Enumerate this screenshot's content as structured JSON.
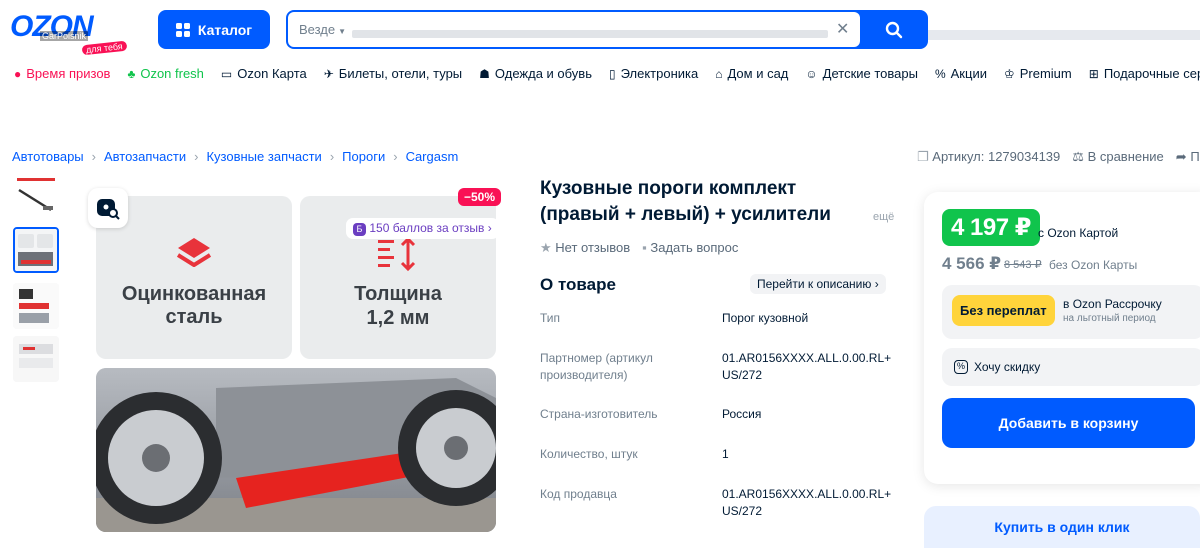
{
  "header": {
    "logo_text": "OZON",
    "logo_overlay": "GarPoisnik",
    "logo_badge": "для тебя",
    "catalog_label": "Каталог",
    "search_scope": "Везде",
    "search_placeholder": ""
  },
  "categories": [
    {
      "label": "Время призов",
      "icon": "gift-circle-icon",
      "color": "#f91155"
    },
    {
      "label": "Ozon fresh",
      "icon": "fresh-icon",
      "color": "#10c44c"
    },
    {
      "label": "Ozon Карта",
      "icon": "card-icon",
      "color": "#001a34"
    },
    {
      "label": "Билеты, отели, туры",
      "icon": "plane-icon",
      "color": "#001a34"
    },
    {
      "label": "Одежда и обувь",
      "icon": "clothes-icon",
      "color": "#001a34"
    },
    {
      "label": "Электроника",
      "icon": "phone-icon",
      "color": "#001a34"
    },
    {
      "label": "Дом и сад",
      "icon": "home-icon",
      "color": "#001a34"
    },
    {
      "label": "Детские товары",
      "icon": "baby-icon",
      "color": "#001a34"
    },
    {
      "label": "Акции",
      "icon": "percent-icon",
      "color": "#001a34"
    },
    {
      "label": "Premium",
      "icon": "crown-icon",
      "color": "#001a34"
    },
    {
      "label": "Подарочные сер",
      "icon": "present-icon",
      "color": "#001a34"
    }
  ],
  "breadcrumbs": [
    "Автотовары",
    "Автозапчасти",
    "Кузовные запчасти",
    "Пороги",
    "Cargasm"
  ],
  "top_actions": {
    "article": "Артикул: 1279034139",
    "compare": "В сравнение",
    "share": "П"
  },
  "gallery": {
    "tile1_text": [
      "Оцинкованная",
      "сталь"
    ],
    "tile2_text": [
      "Толщина",
      "1,2 мм"
    ],
    "discount": "−50%",
    "points": "150 баллов за отзыв"
  },
  "product": {
    "title_line1": "Кузовные пороги комплект",
    "title_line2": "(правый + левый) + усилители",
    "more": "ещё",
    "no_reviews": "Нет отзывов",
    "ask_question": "Задать вопрос",
    "about_title": "О товаре",
    "go_description": "Перейти к описанию",
    "specs": [
      {
        "k": "Тип",
        "v": "Порог кузовной"
      },
      {
        "k": "Партномер (артикул производителя)",
        "v": "01.AR0156XXXX.ALL.0.00.RL+US/272"
      },
      {
        "k": "Страна-изготовитель",
        "v": "Россия"
      },
      {
        "k": "Количество, штук",
        "v": "1"
      },
      {
        "k": "Код продавца",
        "v": "01.AR0156XXXX.ALL.0.00.RL+US/272"
      }
    ]
  },
  "price": {
    "card_price": "4 197 ₽",
    "card_note": "с Ozon Картой",
    "regular_price": "4 566 ₽",
    "old_price": "8 543 ₽",
    "regular_note": "без Ozon Карты",
    "installment_badge": "Без переплат",
    "installment_title": "в Ozon Рассрочку",
    "installment_sub": "на льготный период",
    "want_discount": "Хочу скидку",
    "add_to_cart": "Добавить в корзину",
    "buy_one_click": "Купить в один клик"
  },
  "colors": {
    "brand": "#005bff",
    "accent": "#f91155",
    "green": "#10c44c",
    "yellow": "#ffd43b"
  }
}
